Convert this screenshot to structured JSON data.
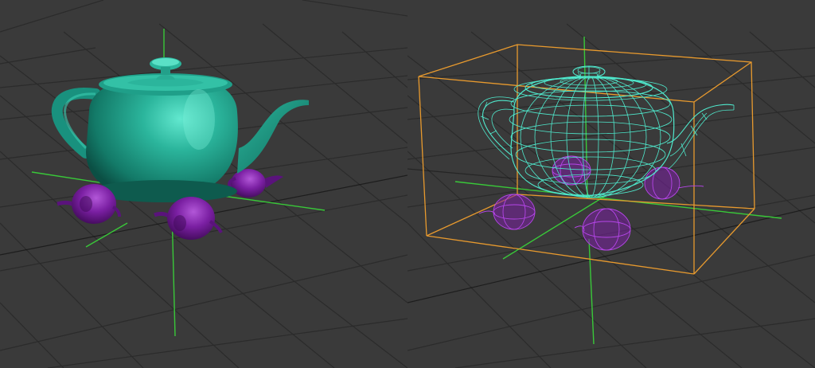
{
  "colors": {
    "background": "#3a3a3a",
    "grid_line": "#2a2a2a",
    "axis_x": "#3ecb3e",
    "axis_y": "#3ecb3e",
    "axis_black": "#111111",
    "teapot_shaded": "#21a58f",
    "teapot_highlight": "#5ae0c6",
    "teapot_shadow": "#0d5a4d",
    "small_teapot": "#7a1fa2",
    "small_teapot_dark": "#4a0d66",
    "small_teapot_light": "#a04ac8",
    "wireframe": "#4fe8cc",
    "bounding_box": "#e89a2e",
    "wire_small": "#b545e8"
  },
  "viewports": [
    {
      "name": "left",
      "mode": "shaded"
    },
    {
      "name": "right",
      "mode": "wireframe-selected"
    }
  ]
}
